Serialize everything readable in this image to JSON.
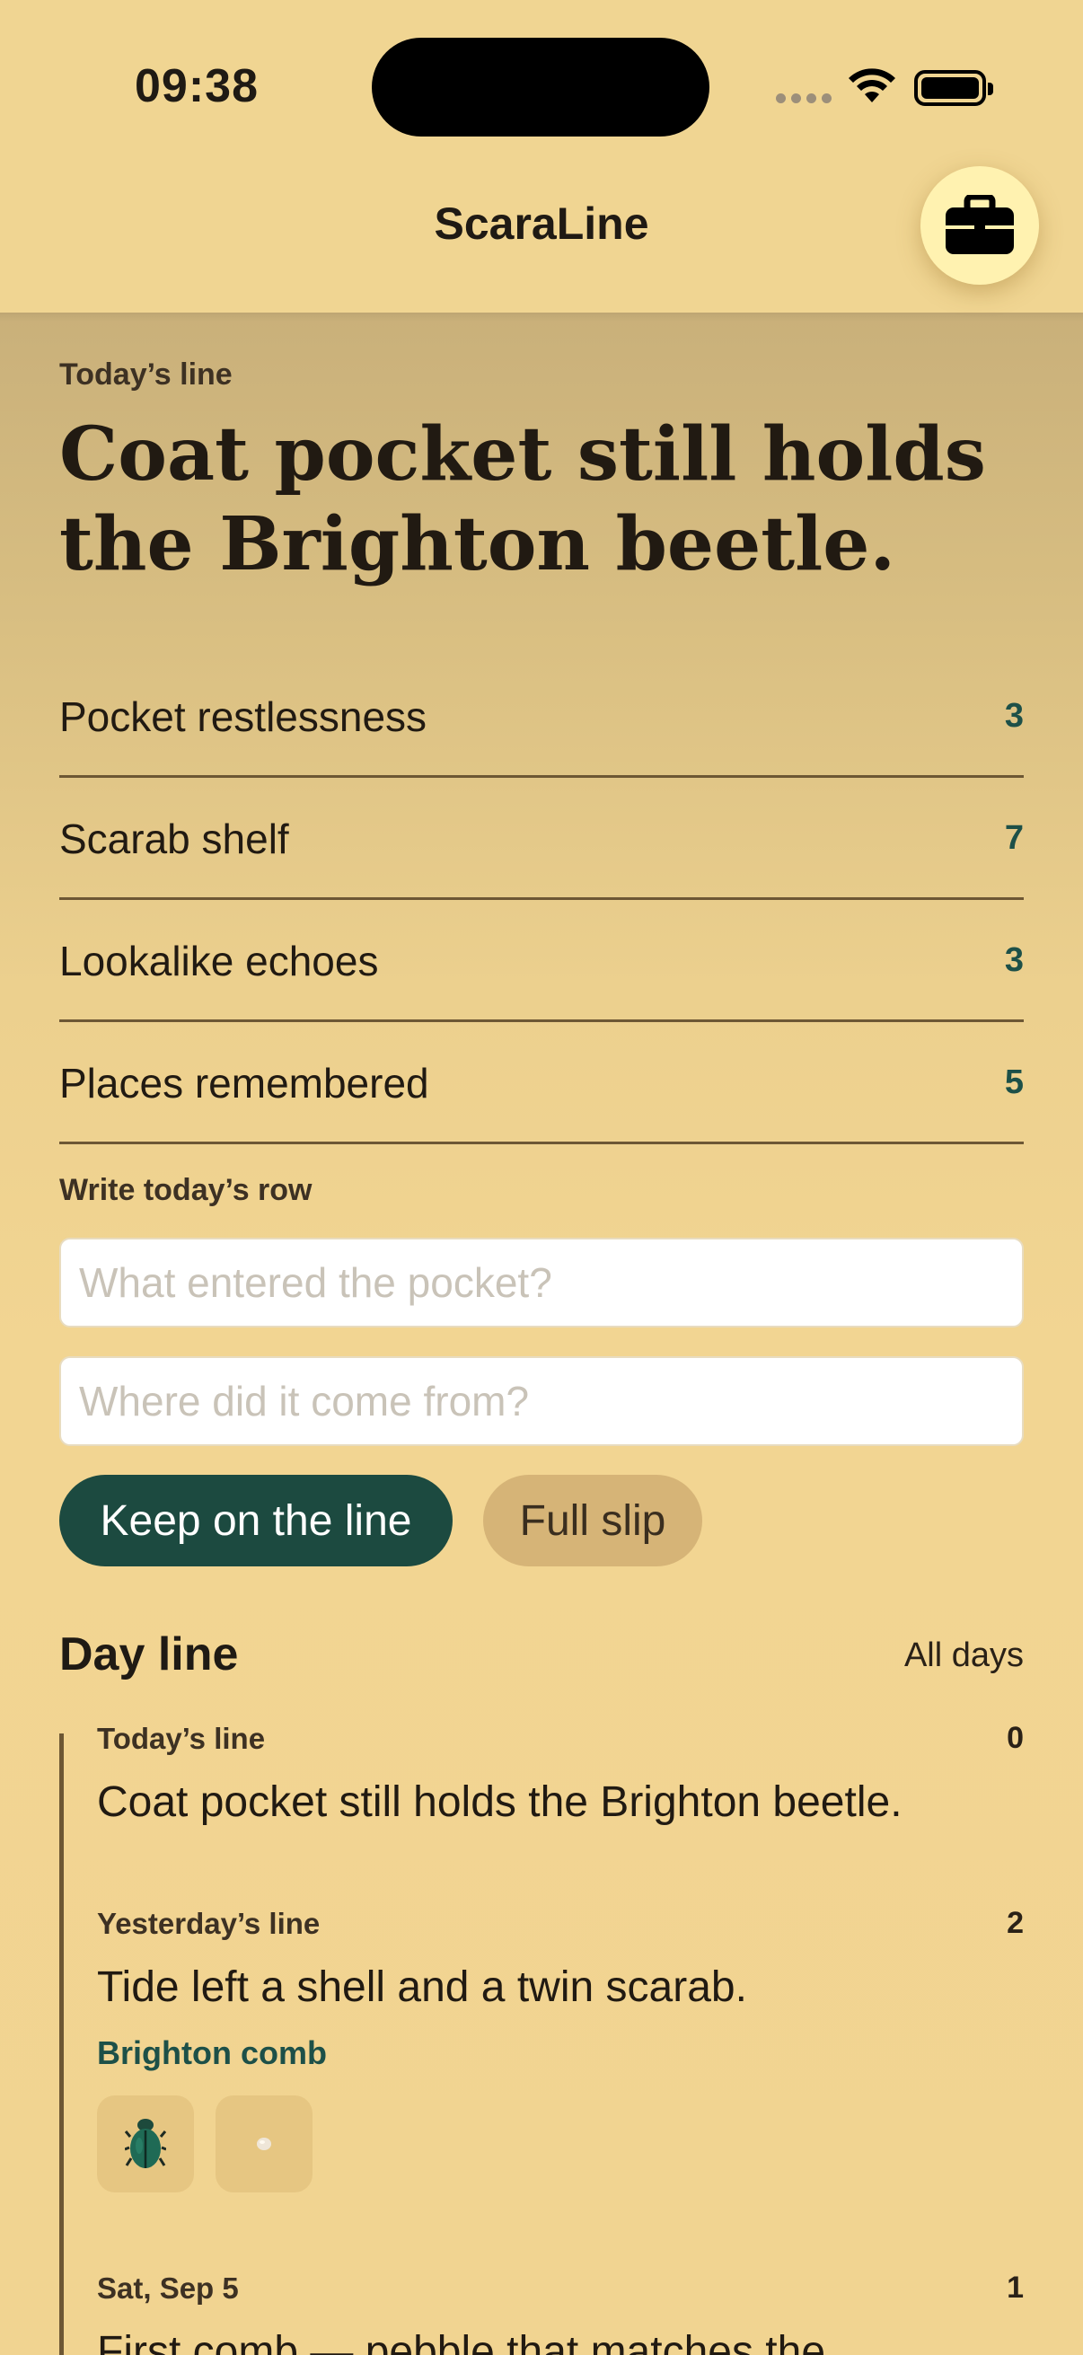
{
  "status_bar": {
    "time": "09:38"
  },
  "header": {
    "title": "ScaraLine",
    "action_icon": "briefcase-icon"
  },
  "today": {
    "eyebrow": "Today’s line",
    "headline": "Coat pocket still holds the Brighton beetle."
  },
  "stats": [
    {
      "label": "Pocket restlessness",
      "count": "3"
    },
    {
      "label": "Scarab shelf",
      "count": "7"
    },
    {
      "label": "Lookalike echoes",
      "count": "3"
    },
    {
      "label": "Places remembered",
      "count": "5"
    }
  ],
  "form": {
    "eyebrow": "Write today’s row",
    "field_what_placeholder": "What entered the pocket?",
    "field_where_placeholder": "Where did it come from?",
    "keep_label": "Keep on the line",
    "slip_label": "Full slip"
  },
  "dayline": {
    "title": "Day line",
    "all_days_label": "All days",
    "entries": [
      {
        "date": "Today’s line",
        "count": "0",
        "text": "Coat pocket still holds the Brighton beetle."
      },
      {
        "date": "Yesterday’s line",
        "count": "2",
        "text": "Tide left a shell and a twin scarab.",
        "tag": "Brighton comb",
        "thumbs": [
          "scarab-beetle-icon",
          "pebble-icon"
        ]
      },
      {
        "date": "Sat, Sep 5",
        "count": "1",
        "text": "First comb — pebble that matches the"
      }
    ]
  },
  "colors": {
    "accent": "#1c4a40",
    "background": "#f0d592",
    "secondary_button": "#d6b477"
  }
}
